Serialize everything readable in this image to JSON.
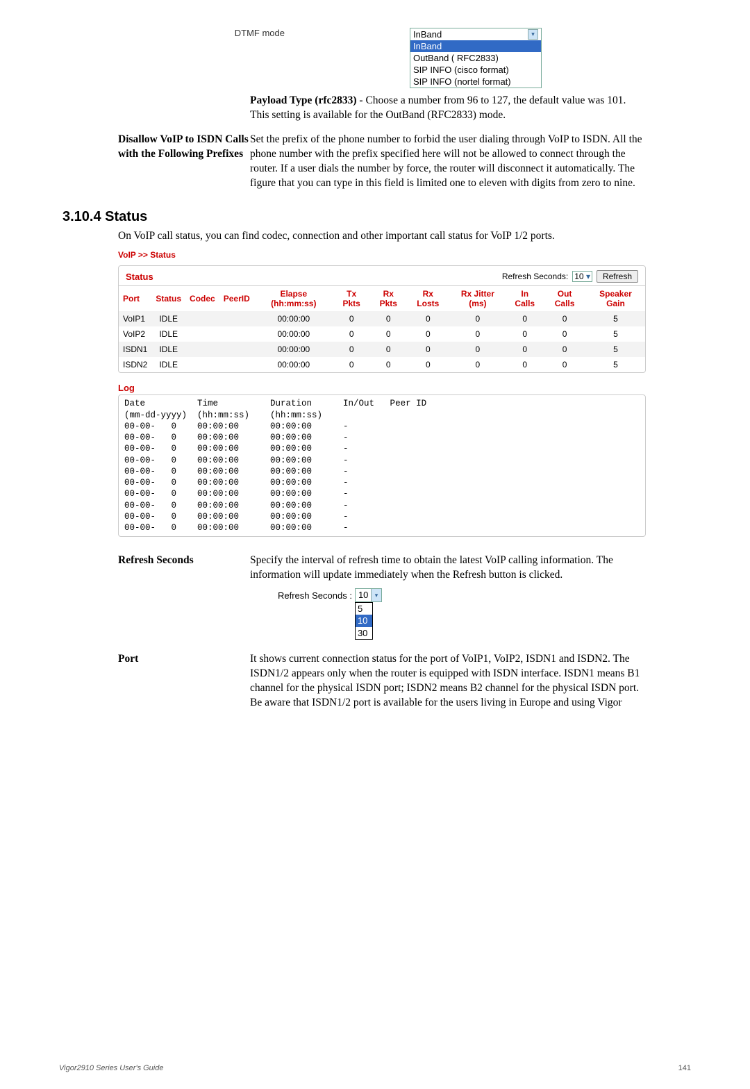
{
  "dtmf": {
    "label": "DTMF mode",
    "selected": "InBand",
    "options": [
      "InBand",
      "OutBand ( RFC2833)",
      "SIP INFO (cisco format)",
      "SIP INFO (nortel format)"
    ]
  },
  "payload_label": "Payload Type (rfc2833) - ",
  "payload_text": "Choose a number from 96 to 127, the default value was 101. This setting is available for the OutBand (RFC2833) mode.",
  "disallow": {
    "term": "Disallow VoIP to ISDN Calls with the Following Prefixes",
    "desc": "Set the prefix of the phone number to forbid the user dialing through VoIP to ISDN. All the phone number with the prefix specified here will not be allowed to connect through the router. If a user dials the number by force, the router will disconnect it automatically. The figure that you can type in this field is limited one to eleven with digits from zero to nine."
  },
  "section_title": "3.10.4 Status",
  "section_intro": "On VoIP call status, you can find codec, connection and other important call status for VoIP 1/2 ports.",
  "crumb": "VoIP >> Status",
  "status": {
    "title": "Status",
    "refresh_label": "Refresh Seconds:",
    "refresh_value": "10",
    "refresh_btn": "Refresh",
    "headers": [
      "Port",
      "Status",
      "Codec",
      "PeerID",
      "Elapse (hh:mm:ss)",
      "Tx Pkts",
      "Rx Pkts",
      "Rx Losts",
      "Rx Jitter (ms)",
      "In Calls",
      "Out Calls",
      "Speaker Gain"
    ],
    "rows": [
      {
        "port": "VoIP1",
        "status": "IDLE",
        "codec": "",
        "peer": "",
        "elapse": "00:00:00",
        "tx": "0",
        "rx": "0",
        "rxl": "0",
        "rxj": "0",
        "in": "0",
        "out": "0",
        "gain": "5"
      },
      {
        "port": "VoIP2",
        "status": "IDLE",
        "codec": "",
        "peer": "",
        "elapse": "00:00:00",
        "tx": "0",
        "rx": "0",
        "rxl": "0",
        "rxj": "0",
        "in": "0",
        "out": "0",
        "gain": "5"
      },
      {
        "port": "ISDN1",
        "status": "IDLE",
        "codec": "",
        "peer": "",
        "elapse": "00:00:00",
        "tx": "0",
        "rx": "0",
        "rxl": "0",
        "rxj": "0",
        "in": "0",
        "out": "0",
        "gain": "5"
      },
      {
        "port": "ISDN2",
        "status": "IDLE",
        "codec": "",
        "peer": "",
        "elapse": "00:00:00",
        "tx": "0",
        "rx": "0",
        "rxl": "0",
        "rxj": "0",
        "in": "0",
        "out": "0",
        "gain": "5"
      }
    ]
  },
  "log": {
    "title": "Log",
    "header": "Date          Time          Duration      In/Out   Peer ID\n(mm-dd-yyyy)  (hh:mm:ss)    (hh:mm:ss)",
    "entries": [
      "00-00-   0    00:00:00      00:00:00      -",
      "00-00-   0    00:00:00      00:00:00      -",
      "00-00-   0    00:00:00      00:00:00      -",
      "00-00-   0    00:00:00      00:00:00      -",
      "00-00-   0    00:00:00      00:00:00      -",
      "00-00-   0    00:00:00      00:00:00      -",
      "00-00-   0    00:00:00      00:00:00      -",
      "00-00-   0    00:00:00      00:00:00      -",
      "00-00-   0    00:00:00      00:00:00      -",
      "00-00-   0    00:00:00      00:00:00      -"
    ]
  },
  "refresh_seconds_def": {
    "term": "Refresh Seconds",
    "desc": "Specify the interval of refresh time to obtain the latest VoIP calling information. The information will update immediately when the Refresh button is clicked.",
    "widget_label": "Refresh Seconds :",
    "selected": "10",
    "options": [
      "5",
      "10",
      "30"
    ]
  },
  "port_def": {
    "term": "Port",
    "desc": "It shows current connection status for the port of VoIP1, VoIP2, ISDN1 and ISDN2. The ISDN1/2 appears only when the router is equipped with ISDN interface. ISDN1 means B1 channel for the physical ISDN port; ISDN2 means B2 channel for the physical ISDN port. Be aware that ISDN1/2 port is available for the users living in Europe and using Vigor"
  },
  "footer_left": "Vigor2910 Series User's Guide",
  "footer_right": "141"
}
